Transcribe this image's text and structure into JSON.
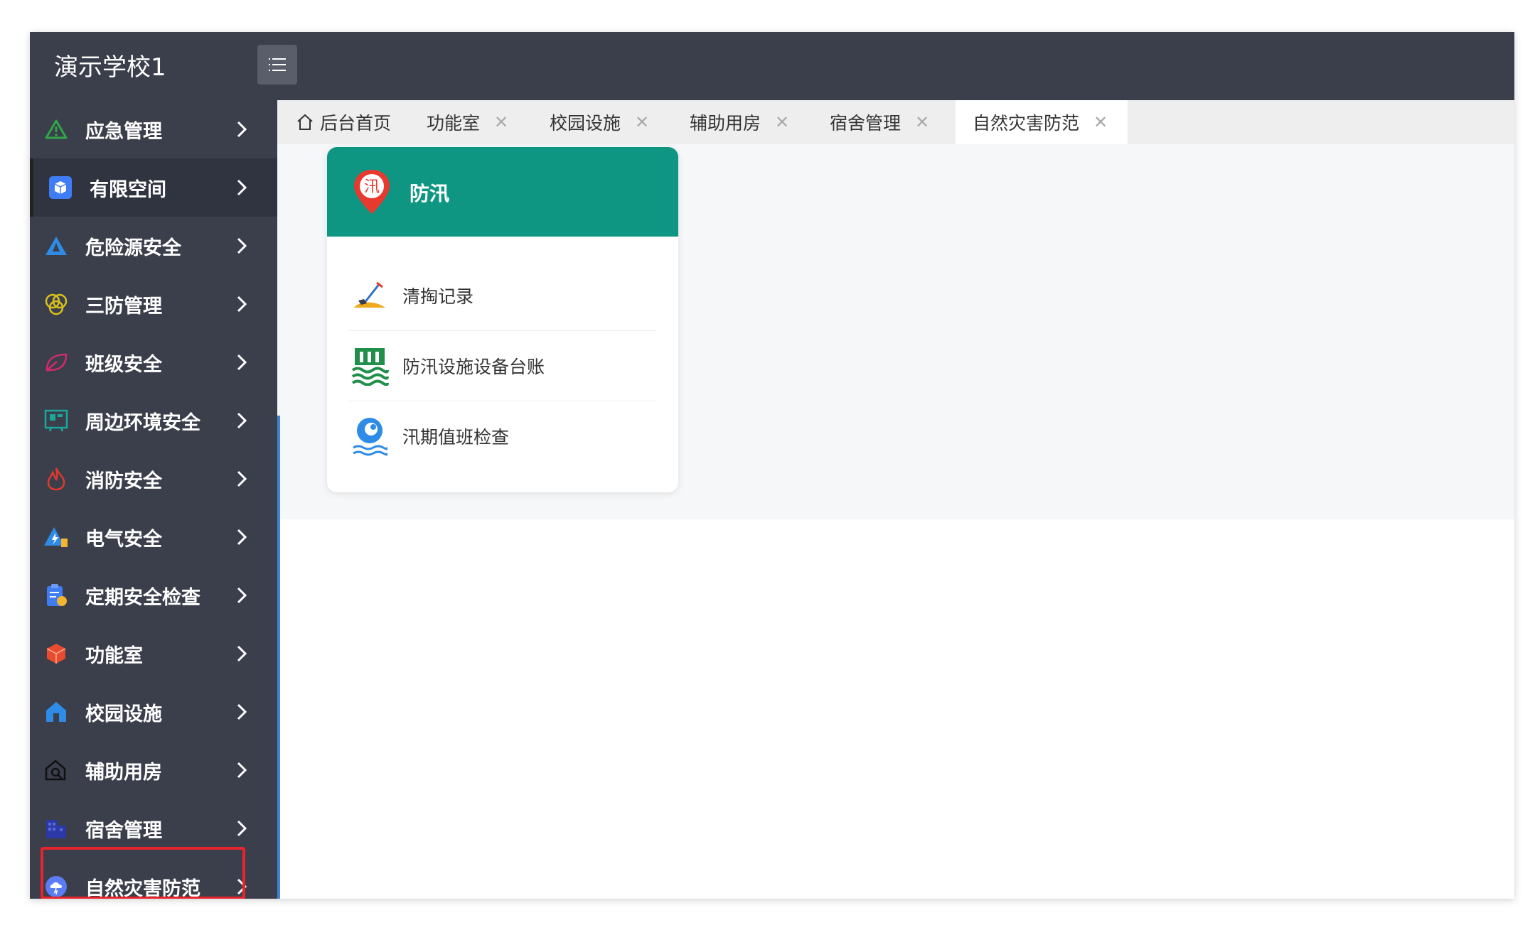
{
  "app": {
    "title": "演示学校1"
  },
  "sidebar": {
    "items": [
      {
        "label": "应急管理",
        "icon": "warning-triangle-icon"
      },
      {
        "label": "有限空间",
        "icon": "cube-box-icon"
      },
      {
        "label": "危险源安全",
        "icon": "hazard-triangle-icon"
      },
      {
        "label": "三防管理",
        "icon": "overlap-shield-icon"
      },
      {
        "label": "班级安全",
        "icon": "leaf-icon"
      },
      {
        "label": "周边环境安全",
        "icon": "board-icon"
      },
      {
        "label": "消防安全",
        "icon": "flame-icon"
      },
      {
        "label": "电气安全",
        "icon": "electric-icon"
      },
      {
        "label": "定期安全检查",
        "icon": "clipboard-check-icon"
      },
      {
        "label": "功能室",
        "icon": "cube-icon"
      },
      {
        "label": "校园设施",
        "icon": "house-icon"
      },
      {
        "label": "辅助用房",
        "icon": "house-search-icon"
      },
      {
        "label": "宿舍管理",
        "icon": "building-icon"
      },
      {
        "label": "自然灾害防范",
        "icon": "cloud-shield-icon"
      }
    ]
  },
  "tabs": [
    {
      "label": "后台首页",
      "closable": false
    },
    {
      "label": "功能室",
      "closable": true
    },
    {
      "label": "校园设施",
      "closable": true
    },
    {
      "label": "辅助用房",
      "closable": true
    },
    {
      "label": "宿舍管理",
      "closable": true
    },
    {
      "label": "自然灾害防范",
      "closable": true
    }
  ],
  "tab_close_glyph": "✕",
  "card": {
    "title": "防汛",
    "badge": "汛",
    "items": [
      {
        "label": "清掏记录",
        "icon": "shovel-icon"
      },
      {
        "label": "防汛设施设备台账",
        "icon": "flood-barrier-icon"
      },
      {
        "label": "汛期值班检查",
        "icon": "water-wave-icon"
      }
    ]
  },
  "colors": {
    "topbar": "#3b3e4b",
    "card_header": "#0f9683",
    "highlight_border": "#e8242c",
    "divider_accent": "#3f83d6"
  }
}
